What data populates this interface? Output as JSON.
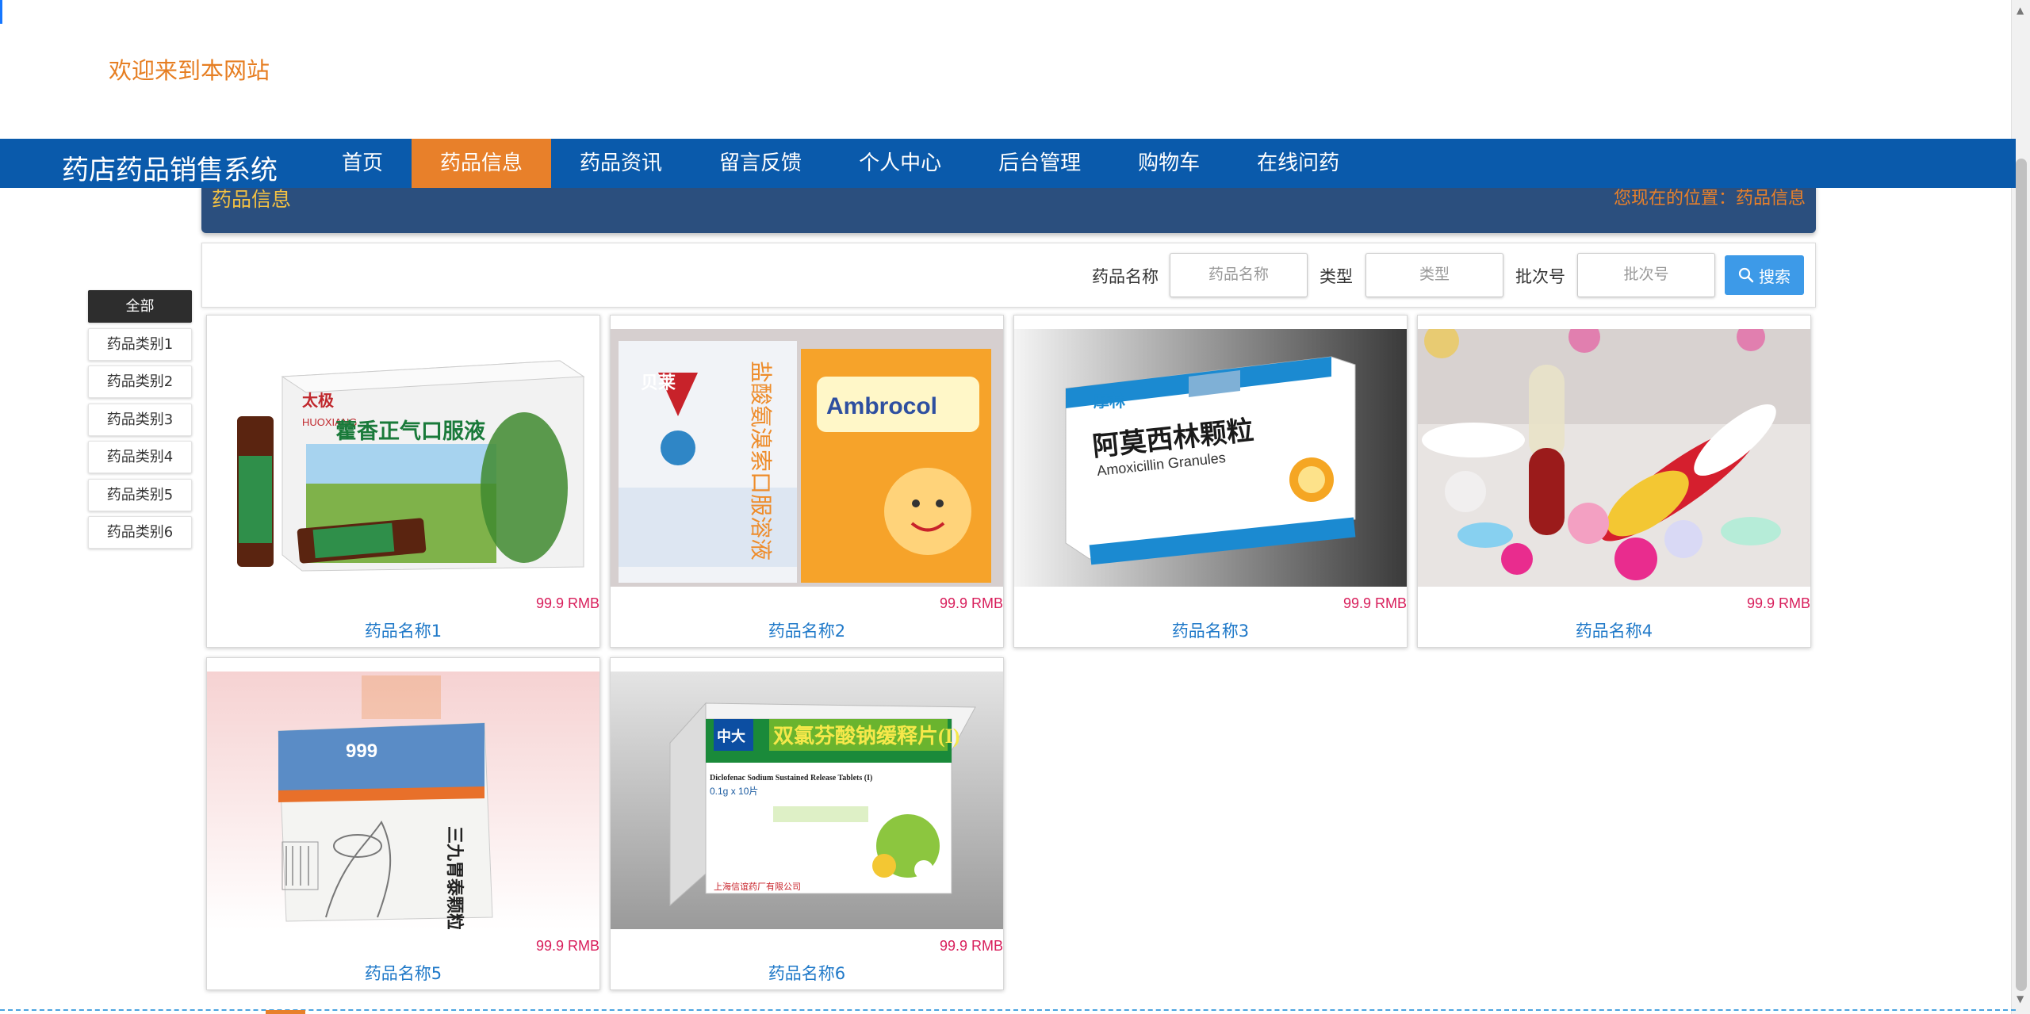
{
  "header": {
    "welcome": "欢迎来到本网站"
  },
  "navbar": {
    "brand": "药店药品销售系统",
    "items": [
      {
        "label": "首页",
        "active": false
      },
      {
        "label": "药品信息",
        "active": true
      },
      {
        "label": "药品资讯",
        "active": false
      },
      {
        "label": "留言反馈",
        "active": false
      },
      {
        "label": "个人中心",
        "active": false
      },
      {
        "label": "后台管理",
        "active": false
      },
      {
        "label": "购物车",
        "active": false
      },
      {
        "label": "在线问药",
        "active": false
      }
    ]
  },
  "breadcrumb": {
    "title": "药品信息",
    "location": "您现在的位置：药品信息"
  },
  "search": {
    "name_label": "药品名称",
    "name_placeholder": "药品名称",
    "type_label": "类型",
    "type_placeholder": "类型",
    "batch_label": "批次号",
    "batch_placeholder": "批次号",
    "button_label": "搜索"
  },
  "categories": [
    "全部",
    "药品类别1",
    "药品类别2",
    "药品类别3",
    "药品类别4",
    "药品类别5",
    "药品类别6"
  ],
  "products": [
    {
      "name": "药品名称1",
      "price": "99.9 RMB"
    },
    {
      "name": "药品名称2",
      "price": "99.9 RMB"
    },
    {
      "name": "药品名称3",
      "price": "99.9 RMB"
    },
    {
      "name": "药品名称4",
      "price": "99.9 RMB"
    },
    {
      "name": "药品名称5",
      "price": "99.9 RMB"
    },
    {
      "name": "药品名称6",
      "price": "99.9 RMB"
    }
  ],
  "product_images": [
    {
      "brand": "太极",
      "title": "藿香正气口服液",
      "pinyin": "HUOXIANG"
    },
    {
      "brand": "贝莱",
      "title": "盐酸氨溴索口服溶液",
      "label": "Ambrocol"
    },
    {
      "brand": "摩林",
      "title": "阿莫西林颗粒",
      "subtitle": "Amoxicillin Granules"
    },
    {},
    {
      "brand": "999",
      "title": "三九胃泰颗粒"
    },
    {
      "brand": "中大",
      "title": "双氯芬酸钠缓释片(I)",
      "subtitle": "Diclofenac Sodium Sustained Release Tablets (I)",
      "spec": "0.1g x 10片",
      "maker": "上海信谊药厂有限公司"
    }
  ],
  "colors": {
    "nav": "#0a5aab",
    "active": "#e8802a",
    "crumb": "#2b4f7e",
    "price": "#d81e5b",
    "name": "#1e78c8"
  }
}
